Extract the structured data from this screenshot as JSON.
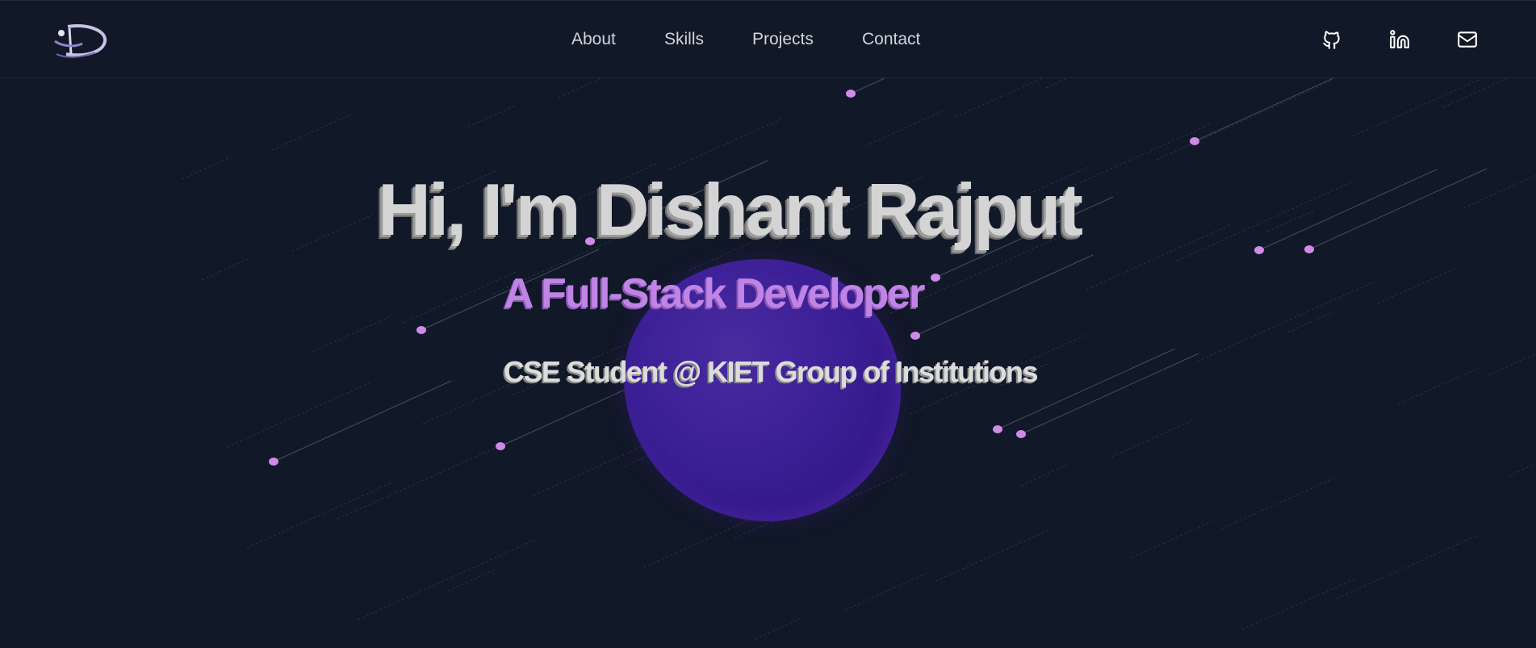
{
  "logo": {
    "icon": "d-logo-icon"
  },
  "nav": {
    "items": [
      {
        "label": "About"
      },
      {
        "label": "Skills"
      },
      {
        "label": "Projects"
      },
      {
        "label": "Contact"
      }
    ]
  },
  "social": {
    "icons": [
      "github-icon",
      "linkedin-icon",
      "mail-icon"
    ]
  },
  "hero": {
    "headline": "Hi, I'm Dishant Rajput",
    "subtitle": "A Full-Stack Developer",
    "tagline": "CSE Student @ KIET Group of Institutions"
  },
  "colors": {
    "background": "#111827",
    "accent": "#c084e6",
    "blob": "#3b1f96",
    "text": "#d4d4d4"
  }
}
